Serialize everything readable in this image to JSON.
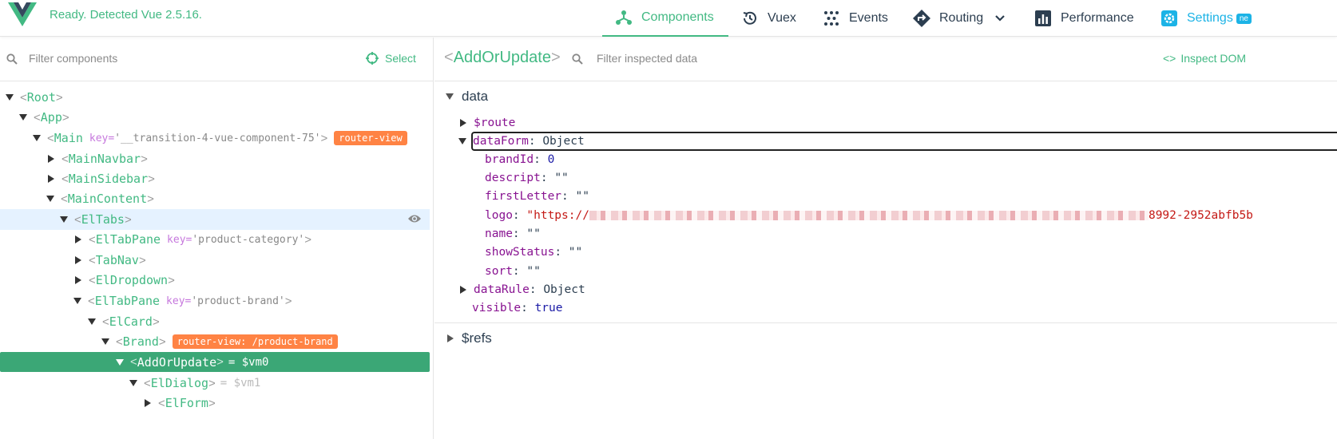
{
  "header": {
    "status": "Ready. Detected Vue 2.5.16.",
    "tabs": [
      {
        "label": "Components",
        "icon": "components-icon",
        "active": true
      },
      {
        "label": "Vuex",
        "icon": "history-icon"
      },
      {
        "label": "Events",
        "icon": "events-icon"
      },
      {
        "label": "Routing",
        "icon": "routing-icon"
      },
      {
        "label": "Performance",
        "icon": "performance-icon"
      },
      {
        "label": "Settings",
        "icon": "settings-icon",
        "badge": "ne"
      }
    ]
  },
  "left": {
    "filter_placeholder": "Filter components",
    "select_label": "Select",
    "tree": [
      {
        "name": "Root",
        "expanded": true
      },
      {
        "name": "App",
        "expanded": true
      },
      {
        "name": "Main",
        "expanded": true,
        "key": "'__transition-4-vue-component-75'",
        "badge": "router-view"
      },
      {
        "name": "MainNavbar",
        "expanded": false
      },
      {
        "name": "MainSidebar",
        "expanded": false
      },
      {
        "name": "MainContent",
        "expanded": true
      },
      {
        "name": "ElTabs",
        "expanded": true
      },
      {
        "name": "ElTabPane",
        "expanded": false,
        "key": "'product-category'"
      },
      {
        "name": "TabNav",
        "expanded": false
      },
      {
        "name": "ElDropdown",
        "expanded": false
      },
      {
        "name": "ElTabPane",
        "expanded": true,
        "key": "'product-brand'"
      },
      {
        "name": "ElCard",
        "expanded": true
      },
      {
        "name": "Brand",
        "expanded": true,
        "badge": "router-view: /product-brand"
      },
      {
        "name": "AddOrUpdate",
        "expanded": true,
        "vm": "= $vm0"
      },
      {
        "name": "ElDialog",
        "expanded": true,
        "vm": "= $vm1"
      },
      {
        "name": "ElForm",
        "expanded": false
      }
    ]
  },
  "right": {
    "inspected": "AddOrUpdate",
    "filter_placeholder": "Filter inspected data",
    "inspect_dom": "Inspect DOM",
    "data_section": "data",
    "refs_section": "$refs",
    "route_key": "$route",
    "dataform_key": "dataForm",
    "dataform_type": "Object",
    "fields": [
      {
        "key": "brandId",
        "value": "0"
      },
      {
        "key": "descript",
        "value": "\"\""
      },
      {
        "key": "firstLetter",
        "value": "\"\""
      },
      {
        "key": "logo",
        "value_prefix": "\"https://",
        "value_suffix": "8992-2952abfb5b"
      },
      {
        "key": "name",
        "value": "\"\""
      },
      {
        "key": "showStatus",
        "value": "\"\""
      },
      {
        "key": "sort",
        "value": "\"\""
      }
    ],
    "datarule_key": "dataRule",
    "datarule_type": "Object",
    "visible_key": "visible",
    "visible_value": "true"
  }
}
